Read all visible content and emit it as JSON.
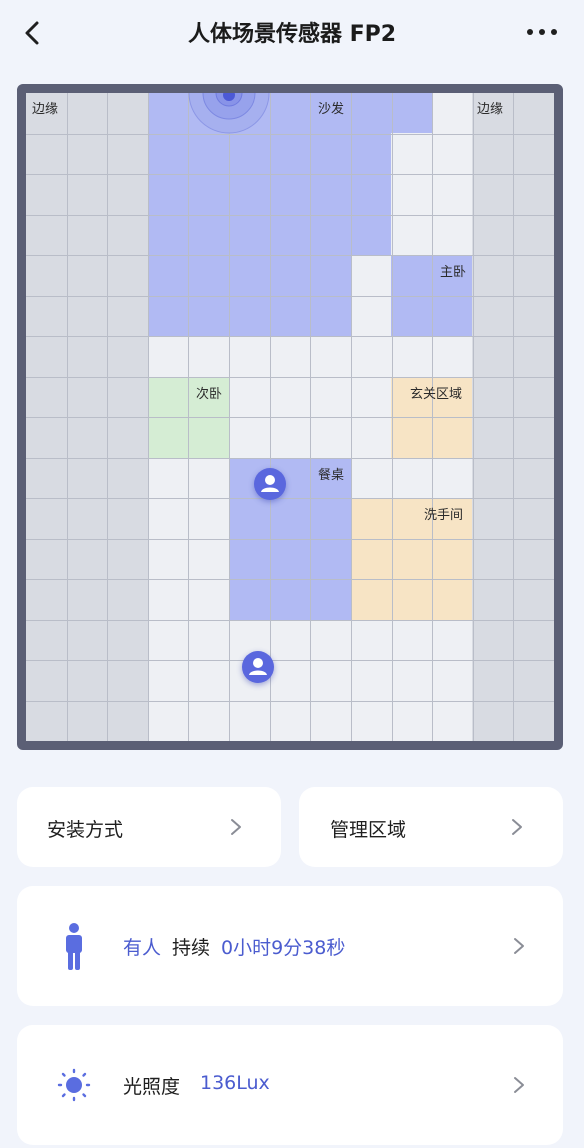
{
  "header": {
    "title": "人体场景传感器 FP2",
    "icons": {
      "back": "chevron-left-icon",
      "more": "more-dots-icon"
    }
  },
  "map": {
    "zones": {
      "edge_left": "边缘",
      "sofa": "沙发",
      "edge_right": "边缘",
      "master_bedroom": "主卧",
      "second_bedroom": "次卧",
      "entrance": "玄关区域",
      "dining_table": "餐桌",
      "washroom": "洗手间"
    },
    "colors": {
      "edge": "#d8dbe2",
      "blue_zone": "#b1baf3",
      "green_zone": "#d5edd4",
      "orange_zone": "#f7e4c5",
      "floor": "#eef0f4",
      "grid": "#b9bdc8",
      "marker": "#5a67de"
    },
    "icons": {
      "sensor": "sensor-radar-icon",
      "person": "person-icon"
    }
  },
  "cards": {
    "install": {
      "label": "安装方式"
    },
    "manage": {
      "label": "管理区域"
    },
    "presence": {
      "status": "有人",
      "duration_prefix": "持续",
      "duration": "0小时9分38秒",
      "icon": "person-standing-icon"
    },
    "light": {
      "label": "光照度",
      "value": "136Lux",
      "icon": "sun-icon"
    }
  }
}
